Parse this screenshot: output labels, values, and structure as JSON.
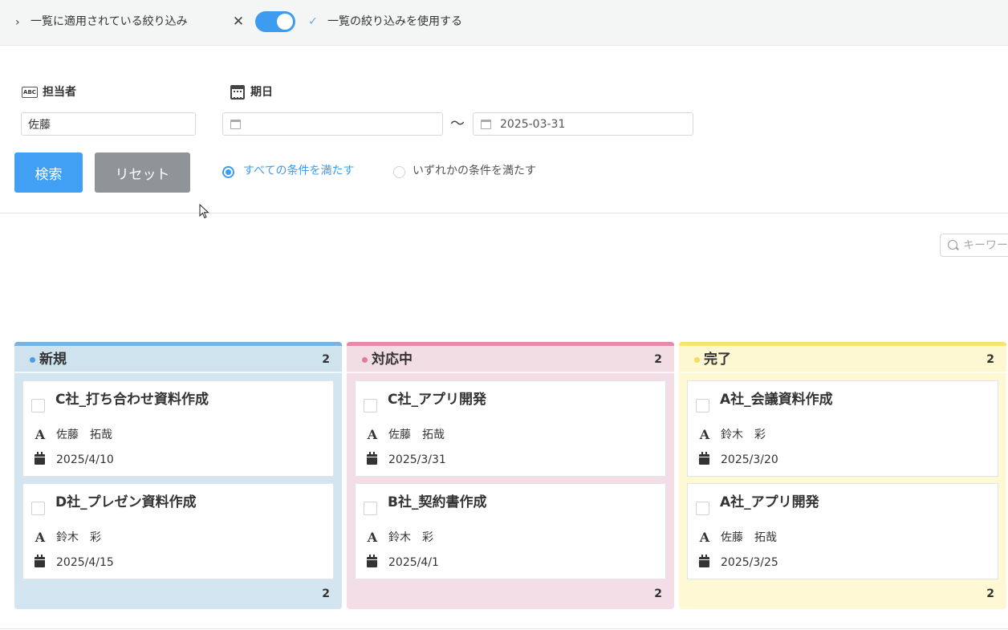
{
  "filterbar": {
    "applied_label": "一覧に適用されている絞り込み",
    "use_list_filter_label": "一覧の絞り込みを使用する",
    "toggle_on": true
  },
  "filters": {
    "assignee_label": "担当者",
    "assignee_value": "佐藤",
    "date_label": "期日",
    "date_from": "",
    "date_to": "2025-03-31",
    "range_separator": "〜",
    "search_button": "検索",
    "reset_button": "リセット",
    "match_all_label": "すべての条件を満たす",
    "match_any_label": "いずれかの条件を満たす",
    "match_selected": "all"
  },
  "keyword_search": {
    "placeholder": "キーワード"
  },
  "board": {
    "columns": [
      {
        "title": "新規",
        "count": "2",
        "footer_count": "2",
        "header_color": "#cfe3ef",
        "border_color": "#7ab4de",
        "body_color": "#d3e5f0",
        "dot_color": "#4a9fe0",
        "cards": [
          {
            "title": "C社_打ち合わせ資料作成",
            "person": "佐藤　拓哉",
            "date": "2025/4/10"
          },
          {
            "title": "D社_プレゼン資料作成",
            "person": "鈴木　彩",
            "date": "2025/4/15"
          }
        ]
      },
      {
        "title": "対応中",
        "count": "2",
        "footer_count": "2",
        "header_color": "#f3dde5",
        "border_color": "#e48aaa",
        "body_color": "#f3dde6",
        "dot_color": "#e07aa0",
        "cards": [
          {
            "title": "C社_アプリ開発",
            "person": "佐藤　拓哉",
            "date": "2025/3/31"
          },
          {
            "title": "B社_契約書作成",
            "person": "鈴木　彩",
            "date": "2025/4/1"
          }
        ]
      },
      {
        "title": "完了",
        "count": "2",
        "footer_count": "2",
        "header_color": "#fdf7d2",
        "border_color": "#f7e56c",
        "body_color": "#fef9d4",
        "dot_color": "#f5dc5a",
        "cards": [
          {
            "title": "A社_会議資料作成",
            "person": "鈴木　彩",
            "date": "2025/3/20"
          },
          {
            "title": "A社_アプリ開発",
            "person": "佐藤　拓哉",
            "date": "2025/3/25"
          }
        ]
      }
    ]
  }
}
